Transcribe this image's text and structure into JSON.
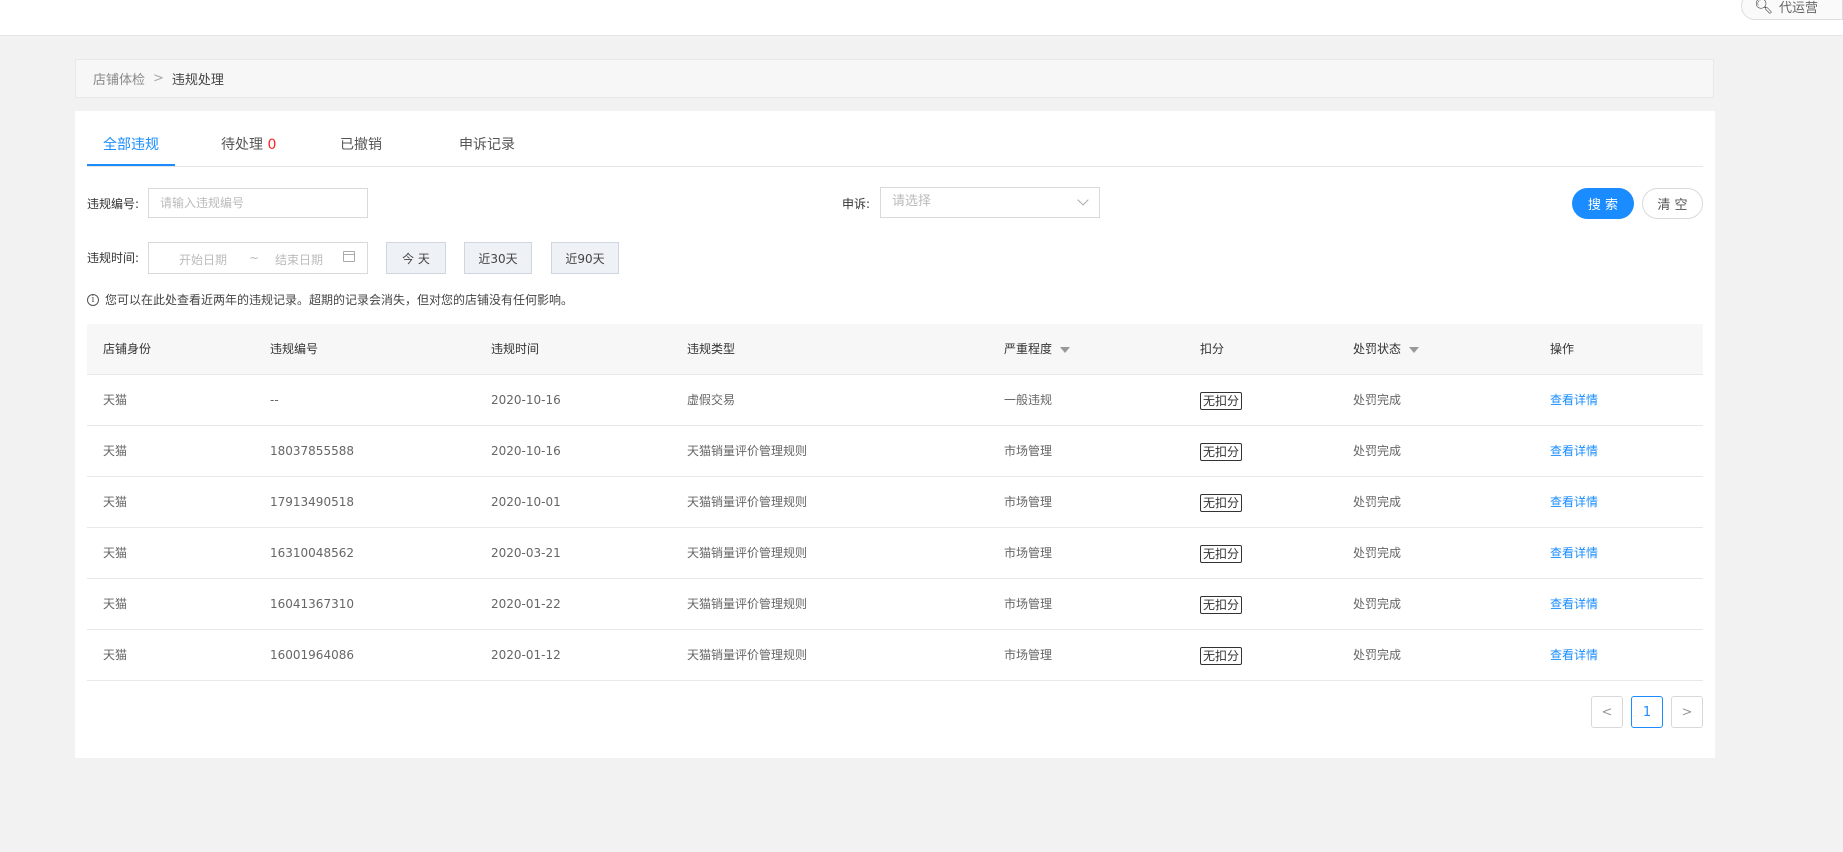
{
  "topbar": {
    "search_icon": "search-icon",
    "search_text": "代运营"
  },
  "breadcrumb": {
    "items": [
      "店铺体检",
      "违规处理"
    ],
    "separator": ">"
  },
  "tabs": [
    {
      "label": "全部违规",
      "active": true
    },
    {
      "label": "待处理",
      "count": "0"
    },
    {
      "label": "已撤销"
    },
    {
      "label": "申诉记录"
    }
  ],
  "filters": {
    "violation_no_label": "违规编号:",
    "violation_no_placeholder": "请输入违规编号",
    "appeal_label": "申诉:",
    "appeal_placeholder": "请选择",
    "search_label": "搜 索",
    "clear_label": "清 空",
    "time_label": "违规时间:",
    "start_placeholder": "开始日期",
    "range_sep": "~",
    "end_placeholder": "结束日期",
    "quick": [
      "今 天",
      "近30天",
      "近90天"
    ]
  },
  "notice": "您可以在此处查看近两年的违规记录。超期的记录会消失，但对您的店铺没有任何影响。",
  "table": {
    "headers": [
      "店铺身份",
      "违规编号",
      "违规时间",
      "违规类型",
      "严重程度",
      "扣分",
      "处罚状态",
      "操作"
    ],
    "rows": [
      [
        "天猫",
        "--",
        "2020-10-16",
        "虚假交易",
        "一般违规",
        "无扣分",
        "处罚完成",
        "查看详情"
      ],
      [
        "天猫",
        "18037855588",
        "2020-10-16",
        "天猫销量评价管理规则",
        "市场管理",
        "无扣分",
        "处罚完成",
        "查看详情"
      ],
      [
        "天猫",
        "17913490518",
        "2020-10-01",
        "天猫销量评价管理规则",
        "市场管理",
        "无扣分",
        "处罚完成",
        "查看详情"
      ],
      [
        "天猫",
        "16310048562",
        "2020-03-21",
        "天猫销量评价管理规则",
        "市场管理",
        "无扣分",
        "处罚完成",
        "查看详情"
      ],
      [
        "天猫",
        "16041367310",
        "2020-01-22",
        "天猫销量评价管理规则",
        "市场管理",
        "无扣分",
        "处罚完成",
        "查看详情"
      ],
      [
        "天猫",
        "16001964086",
        "2020-01-12",
        "天猫销量评价管理规则",
        "市场管理",
        "无扣分",
        "处罚完成",
        "查看详情"
      ]
    ]
  },
  "pagination": {
    "prev": "<",
    "current": "1",
    "next": ">"
  },
  "colors": {
    "accent": "#1a8cff",
    "alert": "#ff2222",
    "page_bg": "#f2f2f2"
  }
}
